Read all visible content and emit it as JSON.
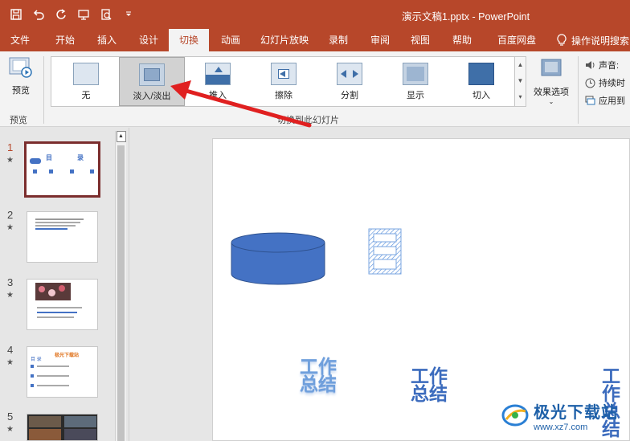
{
  "titlebar": {
    "doc_title": "演示文稿1.pptx  -  PowerPoint",
    "qat_icons": [
      "save-icon",
      "undo-icon",
      "redo-icon",
      "slideshow-icon",
      "print-preview-icon",
      "customize-icon"
    ]
  },
  "tabs": [
    {
      "label": "文件"
    },
    {
      "label": "开始"
    },
    {
      "label": "插入"
    },
    {
      "label": "设计"
    },
    {
      "label": "切换"
    },
    {
      "label": "动画"
    },
    {
      "label": "幻灯片放映"
    },
    {
      "label": "录制"
    },
    {
      "label": "审阅"
    },
    {
      "label": "视图"
    },
    {
      "label": "帮助"
    },
    {
      "label": "百度网盘"
    }
  ],
  "active_tab": "切换",
  "tell_me": "操作说明搜索",
  "ribbon": {
    "preview_label": "预览",
    "preview_group": "预览",
    "transitions": [
      {
        "label": "无",
        "icon": "none-transition-icon"
      },
      {
        "label": "淡入/淡出",
        "icon": "fade-transition-icon"
      },
      {
        "label": "推入",
        "icon": "push-transition-icon"
      },
      {
        "label": "擦除",
        "icon": "wipe-transition-icon"
      },
      {
        "label": "分割",
        "icon": "split-transition-icon"
      },
      {
        "label": "显示",
        "icon": "reveal-transition-icon"
      },
      {
        "label": "切入",
        "icon": "cut-transition-icon"
      }
    ],
    "selected_transition": "淡入/淡出",
    "group_label": "切换到此幻灯片",
    "effect_options": "效果选项",
    "timing": {
      "sound": "声音:",
      "duration": "持续时",
      "apply_all": "应用到"
    }
  },
  "slides": [
    {
      "num": "1",
      "star": "★"
    },
    {
      "num": "2",
      "star": "★"
    },
    {
      "num": "3",
      "star": "★"
    },
    {
      "num": "4",
      "star": "★"
    },
    {
      "num": "5",
      "star": "★"
    }
  ],
  "thumb": {
    "s1_title_a": "目",
    "s1_title_b": "录",
    "s4_title": "极光下载站",
    "s4_label": "目 录"
  },
  "slide_main": {
    "title_char": "目",
    "wordart_line1": "工作",
    "wordart_line2": "总结"
  },
  "watermark": {
    "name": "极光下载站",
    "url": "www.xz7.com"
  },
  "colors": {
    "brand": "#b7472a",
    "cylinder": "#4472c4",
    "annotation": "#e02020"
  }
}
